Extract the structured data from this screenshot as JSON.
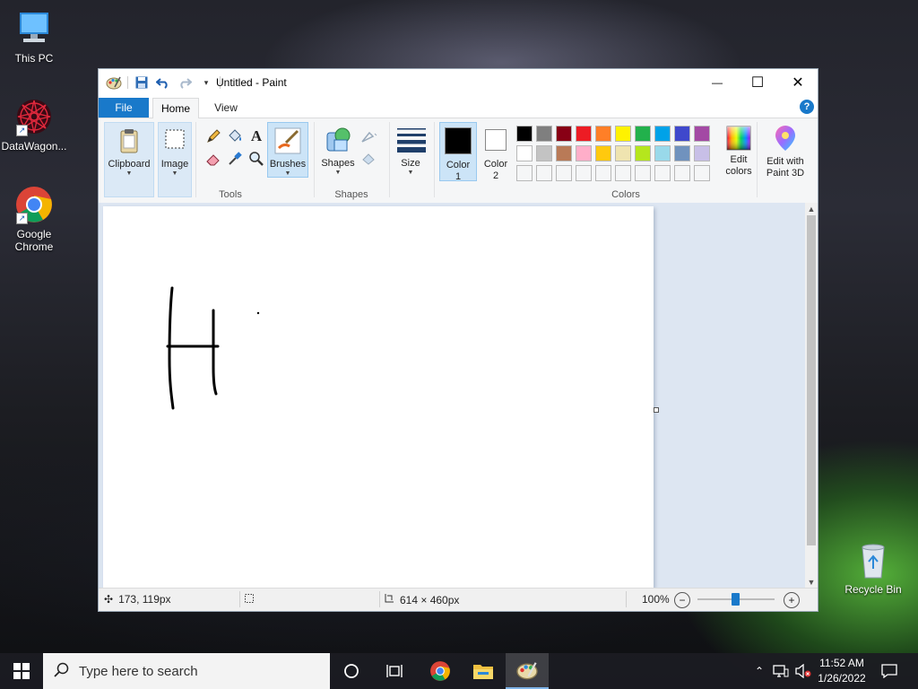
{
  "desktop": {
    "icons": [
      {
        "label": "This PC"
      },
      {
        "label": "DataWagon..."
      },
      {
        "label": "Google Chrome"
      },
      {
        "label": "Recycle Bin"
      }
    ]
  },
  "window": {
    "title": "Untitled - Paint",
    "controls": {
      "minimize": "—",
      "maximize": "☐",
      "close": "✕"
    }
  },
  "tabs": [
    {
      "label": "File"
    },
    {
      "label": "Home"
    },
    {
      "label": "View"
    }
  ],
  "help": "?",
  "ribbon": {
    "clipboard": {
      "label": "Clipboard"
    },
    "image": {
      "label": "Image"
    },
    "tools": {
      "group_label": "Tools"
    },
    "brushes": {
      "label": "Brushes"
    },
    "shapes": {
      "label": "Shapes",
      "group_label": "Shapes"
    },
    "size": {
      "label": "Size"
    },
    "color1": {
      "line1": "Color",
      "line2": "1",
      "value": "#000000"
    },
    "color2": {
      "line1": "Color",
      "line2": "2",
      "value": "#ffffff"
    },
    "colors_group_label": "Colors",
    "edit_colors": {
      "line1": "Edit",
      "line2": "colors"
    },
    "paint3d": {
      "line1": "Edit with",
      "line2": "Paint 3D"
    },
    "palette_row1": [
      "#000000",
      "#7f7f7f",
      "#880015",
      "#ed1c24",
      "#ff7f27",
      "#fff200",
      "#22b14c",
      "#00a2e8",
      "#3f48cc",
      "#a349a4"
    ],
    "palette_row2": [
      "#ffffff",
      "#c3c3c3",
      "#b97a57",
      "#ffaec9",
      "#ffc90e",
      "#efe4b0",
      "#b5e61d",
      "#99d9ea",
      "#7092be",
      "#c8bfe7"
    ],
    "palette_row3": [
      "#f5f6f7",
      "#f5f6f7",
      "#f5f6f7",
      "#f5f6f7",
      "#f5f6f7",
      "#f5f6f7",
      "#f5f6f7",
      "#f5f6f7",
      "#f5f6f7",
      "#f5f6f7"
    ]
  },
  "status": {
    "cursor_pos": "173, 119px",
    "selection_size": "",
    "canvas_size": "614 × 460px",
    "zoom": "100%"
  },
  "taskbar": {
    "search_placeholder": "Type here to search",
    "time": "11:52 AM",
    "date": "1/26/2022"
  }
}
